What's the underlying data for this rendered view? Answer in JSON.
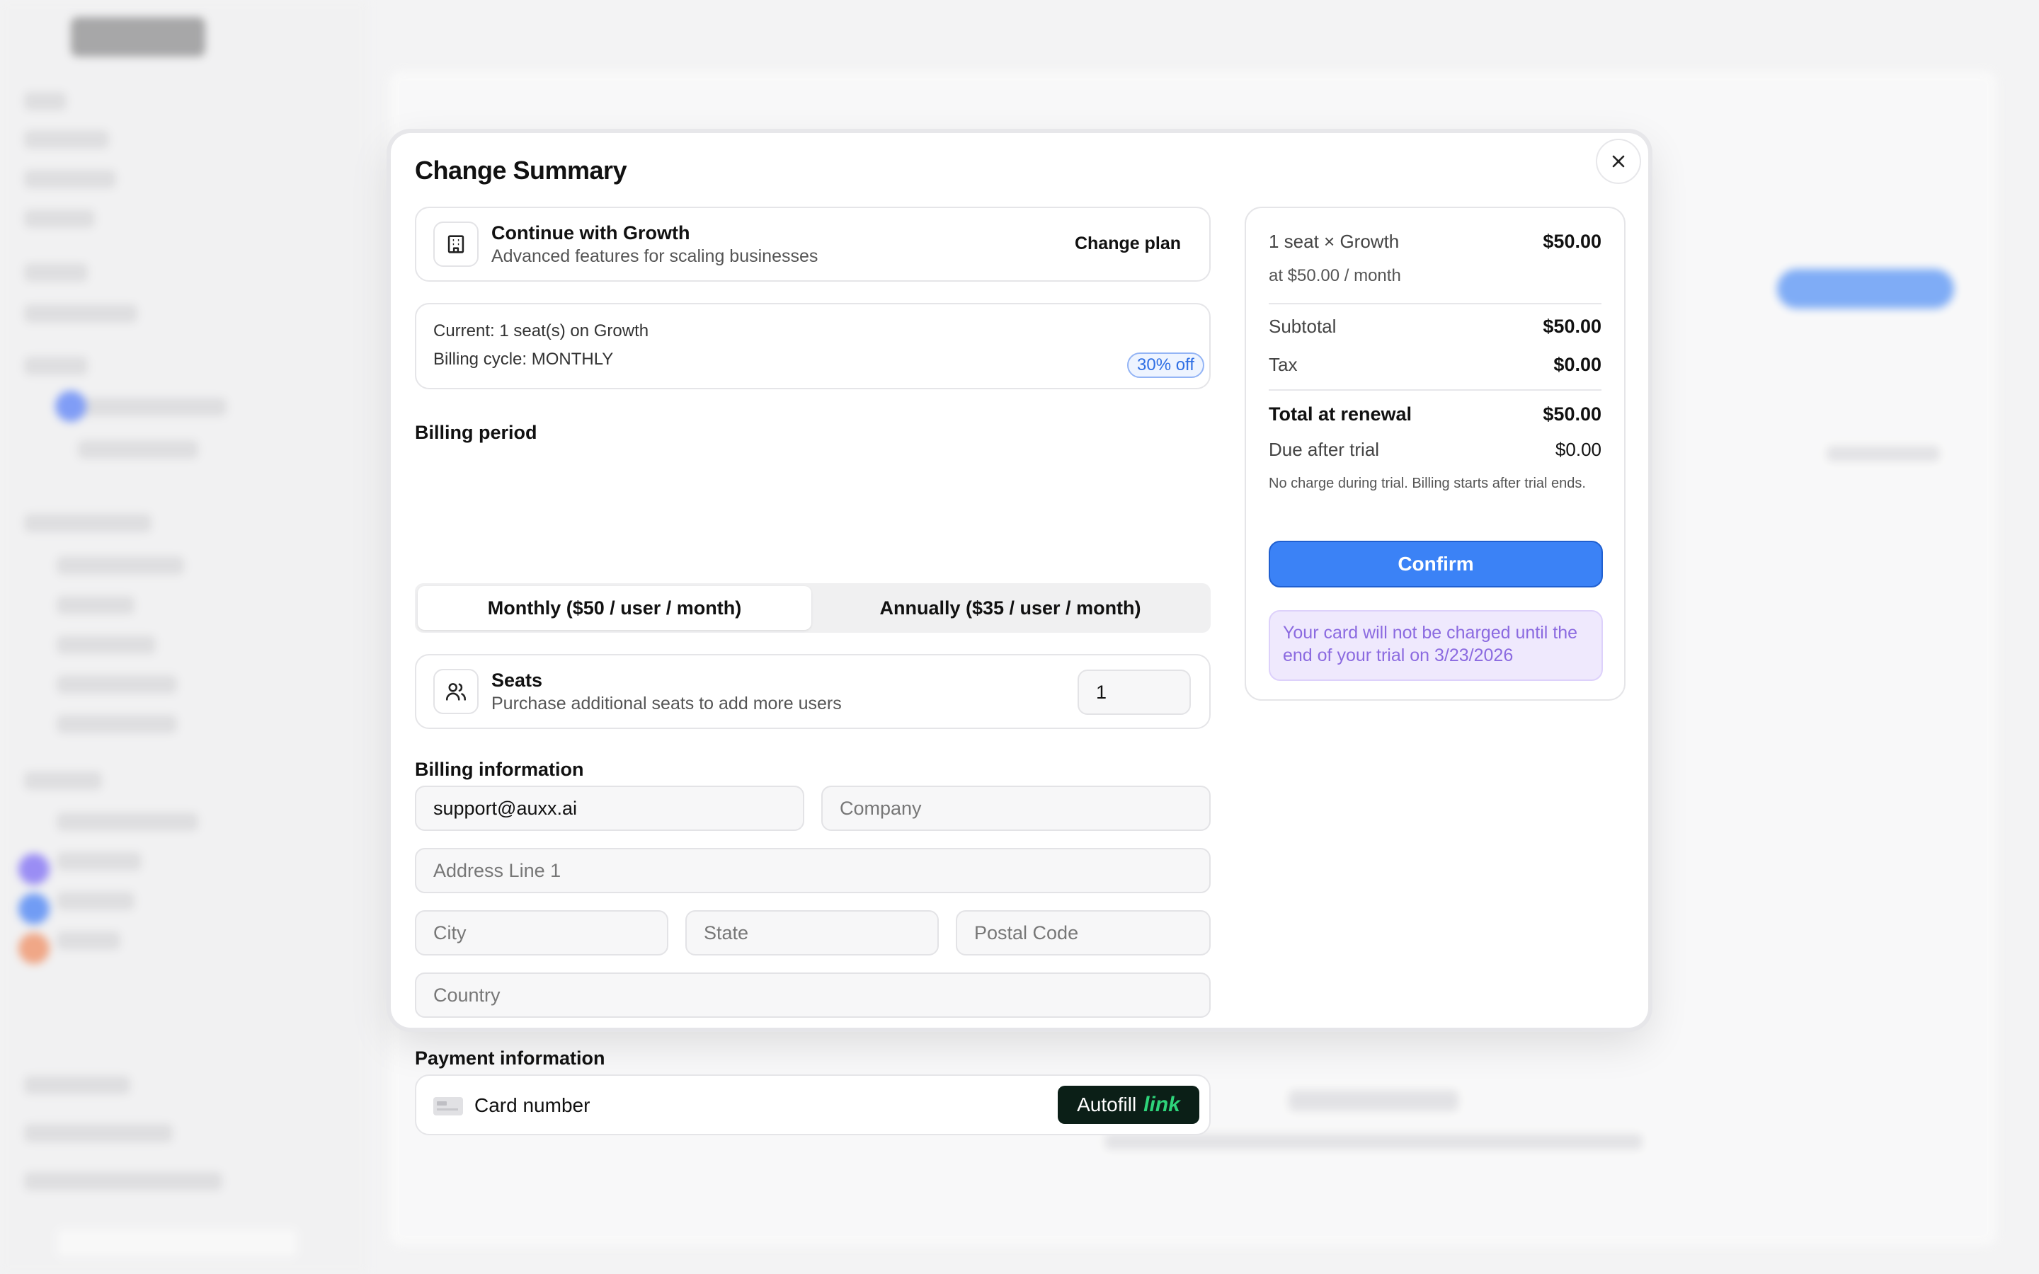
{
  "modal": {
    "title": "Change Summary",
    "close_icon": "close-icon"
  },
  "plan": {
    "title": "Continue with Growth",
    "description": "Advanced features for scaling businesses",
    "change_label": "Change plan",
    "icon": "building-icon"
  },
  "current": {
    "line1": "Current: 1 seat(s) on Growth",
    "line2": "Billing cycle: MONTHLY"
  },
  "billing_period": {
    "label": "Billing period",
    "discount_badge": "30% off",
    "options": [
      {
        "label": "Monthly ($50 / user / month)",
        "selected": true
      },
      {
        "label": "Annually ($35 / user / month)",
        "selected": false
      }
    ]
  },
  "seats": {
    "title": "Seats",
    "description": "Purchase additional seats to add more users",
    "value": "1",
    "icon": "users-icon"
  },
  "billing_info": {
    "label": "Billing information",
    "email_value": "support@auxx.ai",
    "company_placeholder": "Company",
    "address_placeholder": "Address Line 1",
    "city_placeholder": "City",
    "state_placeholder": "State",
    "postal_placeholder": "Postal Code",
    "country_placeholder": "Country"
  },
  "payment": {
    "label": "Payment information",
    "card_label": "Card number",
    "autofill_text": "Autofill",
    "autofill_link": "link",
    "icon": "credit-card-icon"
  },
  "summary": {
    "line_item": "1 seat × Growth",
    "line_item_value": "$50.00",
    "rate": "at $50.00 / month",
    "subtotal_label": "Subtotal",
    "subtotal_value": "$50.00",
    "tax_label": "Tax",
    "tax_value": "$0.00",
    "total_label": "Total at renewal",
    "total_value": "$50.00",
    "due_label": "Due after trial",
    "due_value": "$0.00",
    "note": "No charge during trial. Billing starts after trial ends.",
    "confirm_label": "Confirm",
    "trial_message": "Your card will not be charged until the end of your trial on 3/23/2026"
  },
  "colors": {
    "primary": "#3b82f6",
    "trial_bg": "#efe9fd",
    "trial_text": "#8b6ae0",
    "link_green": "#2ed47a"
  }
}
